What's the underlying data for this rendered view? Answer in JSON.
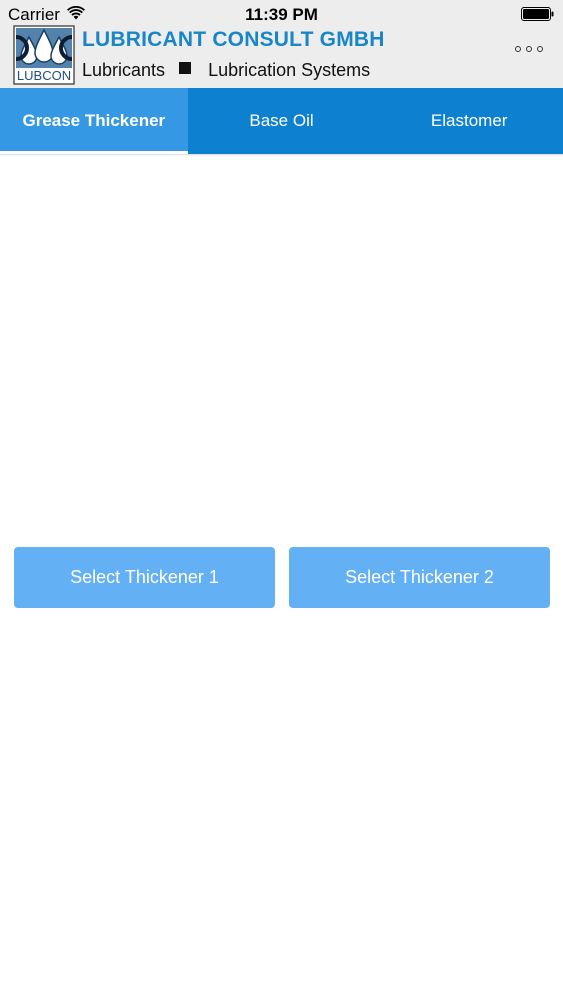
{
  "status_bar": {
    "carrier": "Carrier",
    "time": "11:39 PM",
    "wifi_icon": "wifi-icon",
    "battery_icon": "battery-icon"
  },
  "header": {
    "logo_text": "LUBCON",
    "brand_name": "LUBRICANT CONSULT GMBH",
    "tagline_left": "Lubricants",
    "tagline_right": "Lubrication Systems",
    "more_icon": "more-icon",
    "brand_color": "#1a86c6"
  },
  "tabs": [
    {
      "label": "Grease Thickener",
      "active": true
    },
    {
      "label": "Base Oil",
      "active": false
    },
    {
      "label": "Elastomer",
      "active": false
    }
  ],
  "colors": {
    "tab_bar": "#0d80cf",
    "tab_active": "#3598e4",
    "button": "#64b0f5"
  },
  "main": {
    "select_thickener_1": "Select Thickener 1",
    "select_thickener_2": "Select Thickener 2"
  }
}
